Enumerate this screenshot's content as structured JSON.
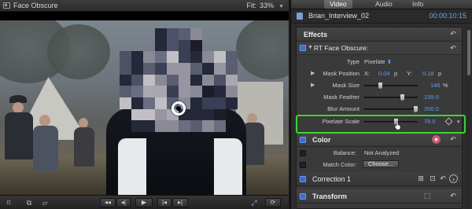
{
  "viewer": {
    "title": "Face Obscure",
    "fit_label": "Fit:",
    "fit_value": "33%"
  },
  "inspector": {
    "tabs": [
      {
        "label": "Video",
        "active": true
      },
      {
        "label": "Audio",
        "active": false
      },
      {
        "label": "Info",
        "active": false
      }
    ],
    "clip_name": "Brian_Interview_02",
    "timecode": "00:00:10:15",
    "effects_heading": "Effects",
    "effect": {
      "name": "RT Face Obscure:",
      "type_label": "Type",
      "type_value": "Pixelate",
      "mask_position_label": "Mask Position",
      "x_label": "X:",
      "x_value": "0.04",
      "x_unit": "p",
      "y_label": "Y:",
      "y_value": "0.18",
      "y_unit": "p",
      "mask_size_label": "Mask Size",
      "mask_size_value": "146",
      "mask_size_unit": "%",
      "mask_feather_label": "Mask Feather",
      "mask_feather_value": "139.0",
      "blur_amount_label": "Blur Amount",
      "blur_amount_value": "200.0",
      "pixelate_scale_label": "Pixelate Scale",
      "pixelate_scale_value": "78.0"
    },
    "color": {
      "title": "Color",
      "balance_label": "Balance:",
      "balance_value": "Not Analyzed",
      "match_label": "Match Color:",
      "choose_label": "Choose..."
    },
    "correction_title": "Correction 1",
    "transform_title": "Transform"
  },
  "colors": {
    "accent_blue": "#3d6bd2",
    "timecode_blue": "#6ea3f3",
    "highlight_green": "#38d630"
  }
}
